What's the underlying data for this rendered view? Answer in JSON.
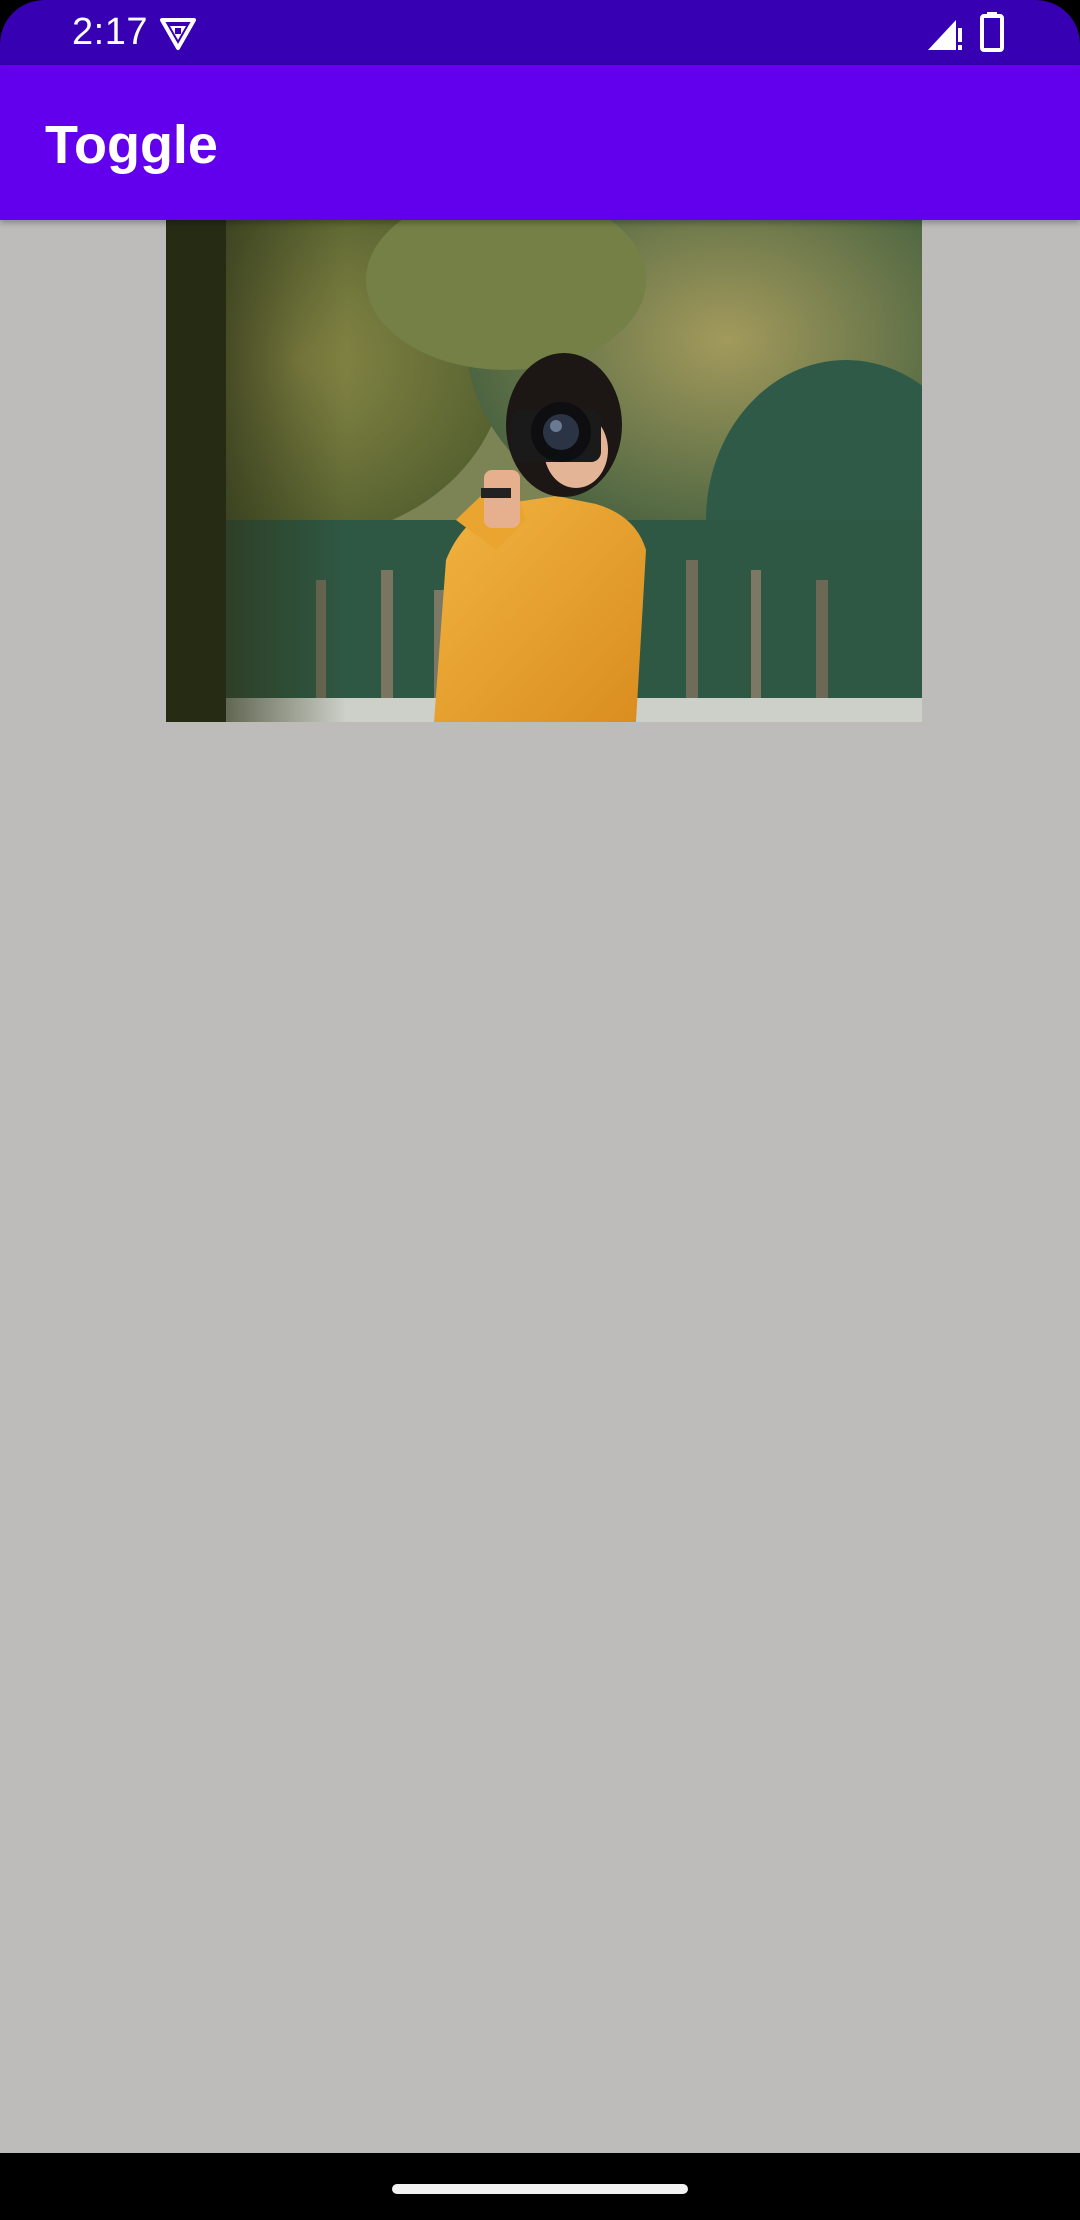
{
  "status_bar": {
    "time": "2:17",
    "background": "#3700b3",
    "icons": [
      "vpn-key-icon",
      "signal-no-data-icon",
      "battery-icon"
    ]
  },
  "app_bar": {
    "title": "Toggle",
    "background": "#6200ee"
  },
  "content": {
    "background": "#bdbcbb",
    "image": {
      "subject": "photographer-in-park-photo"
    }
  },
  "navigation": {
    "gesture_handle": "home-handle"
  }
}
